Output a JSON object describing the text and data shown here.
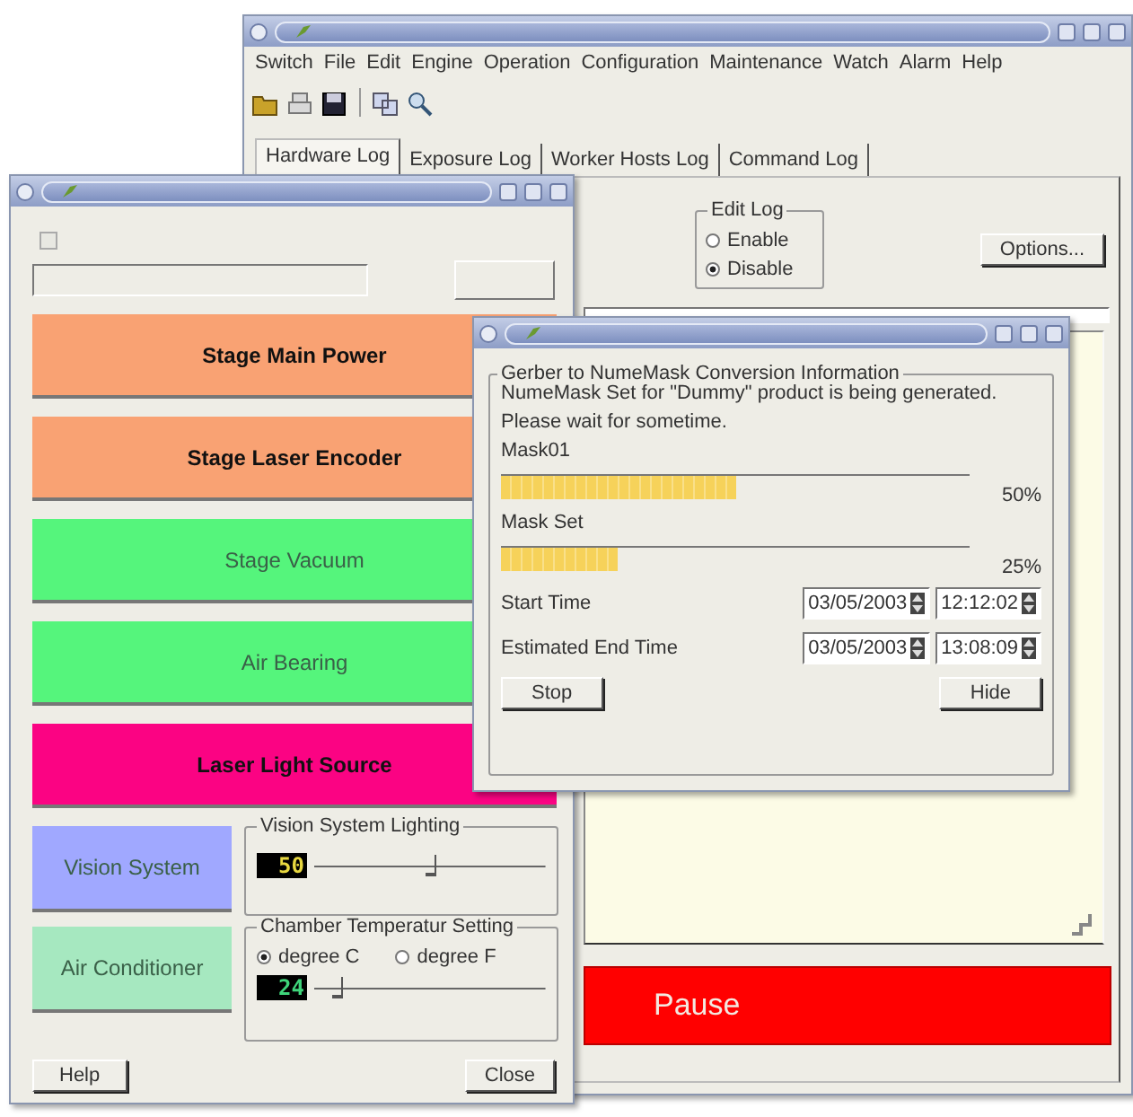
{
  "main_window": {
    "menu": [
      "Switch",
      "File",
      "Edit",
      "Engine",
      "Operation",
      "Configuration",
      "Maintenance",
      "Watch",
      "Alarm",
      "Help"
    ],
    "tabs": [
      {
        "label": "Hardware Log",
        "selected": true
      },
      {
        "label": "Exposure Log",
        "selected": false
      },
      {
        "label": "Worker Hosts Log",
        "selected": false
      },
      {
        "label": "Command Log",
        "selected": false
      }
    ],
    "edit_log": {
      "title": "Edit Log",
      "options": [
        {
          "label": "Enable",
          "selected": false
        },
        {
          "label": "Disable",
          "selected": true
        }
      ]
    },
    "options_button": "Options...",
    "pause_button": "Pause"
  },
  "control_window": {
    "power_checkbox": {
      "checked": false
    },
    "buttons": [
      {
        "label": "Stage Main Power",
        "color": "#f9a273",
        "disabled": false
      },
      {
        "label": "Stage Laser Encoder",
        "color": "#f9a273",
        "disabled": false
      },
      {
        "label": "Stage Vacuum",
        "color": "#55f57c",
        "disabled": true
      },
      {
        "label": "Air Bearing",
        "color": "#55f57c",
        "disabled": true
      },
      {
        "label": "Laser Light Source",
        "color": "#fb0383",
        "disabled": false
      }
    ],
    "vision_button": {
      "label": "Vision System",
      "color": "#a0a8ff",
      "disabled": true
    },
    "lighting": {
      "title": "Vision System Lighting",
      "reading": "50",
      "level": 0.5
    },
    "aircon_button": {
      "label": "Air Conditioner",
      "color": "#a6e8c0",
      "disabled": true
    },
    "temperature": {
      "title": "Chamber Temperatur Setting",
      "units": [
        {
          "label": "degree C",
          "selected": true
        },
        {
          "label": "degree F",
          "selected": false
        }
      ],
      "reading": "24",
      "level": 0.1
    },
    "help_button": "Help",
    "close_button": "Close"
  },
  "progress_window": {
    "group_title": "Gerber to NumeMask Conversion Information",
    "message": [
      "NumeMask Set for \"Dummy\" product is being generated.",
      "Please wait for sometime."
    ],
    "bars": [
      {
        "label": "Mask01",
        "level": 0.5,
        "reading": "50%"
      },
      {
        "label": "Mask Set",
        "level": 0.25,
        "reading": "25%"
      }
    ],
    "times": [
      {
        "label": "Start Time",
        "date": "03/05/2003",
        "time": "12:12:02"
      },
      {
        "label": "Estimated End Time",
        "date": "03/05/2003",
        "time": "13:08:09"
      }
    ],
    "stop_button": "Stop",
    "hide_button": "Hide"
  }
}
